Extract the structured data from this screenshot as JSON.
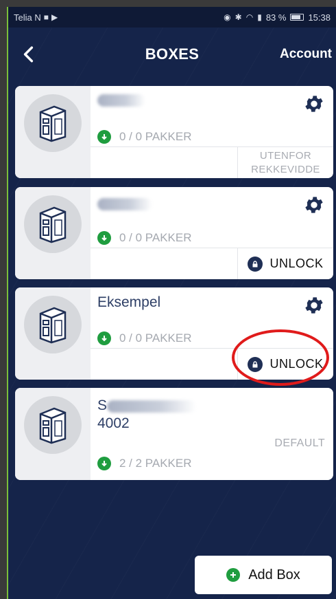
{
  "status_bar": {
    "carrier": "Telia N",
    "battery": "83 %",
    "time": "15:38"
  },
  "header": {
    "title": "BOXES",
    "account_label": "Account"
  },
  "boxes": [
    {
      "name": "",
      "pakker": "0 / 0 PAKKER",
      "status_line1": "UTENFOR",
      "status_line2": "REKKEVIDDE"
    },
    {
      "name": "",
      "pakker": "0 / 0 PAKKER",
      "action": "UNLOCK"
    },
    {
      "name": "Eksempel",
      "pakker": "0 / 0 PAKKER",
      "action": "UNLOCK"
    },
    {
      "name_top": "S",
      "name": "4002",
      "pakker": "2 / 2 PAKKER",
      "status": "DEFAULT"
    }
  ],
  "add_box_label": "Add Box",
  "colors": {
    "background": "#15244a",
    "accent_green": "#1f9d3f",
    "title_blue": "#2e3f66",
    "annotation_red": "#e01b1b"
  }
}
